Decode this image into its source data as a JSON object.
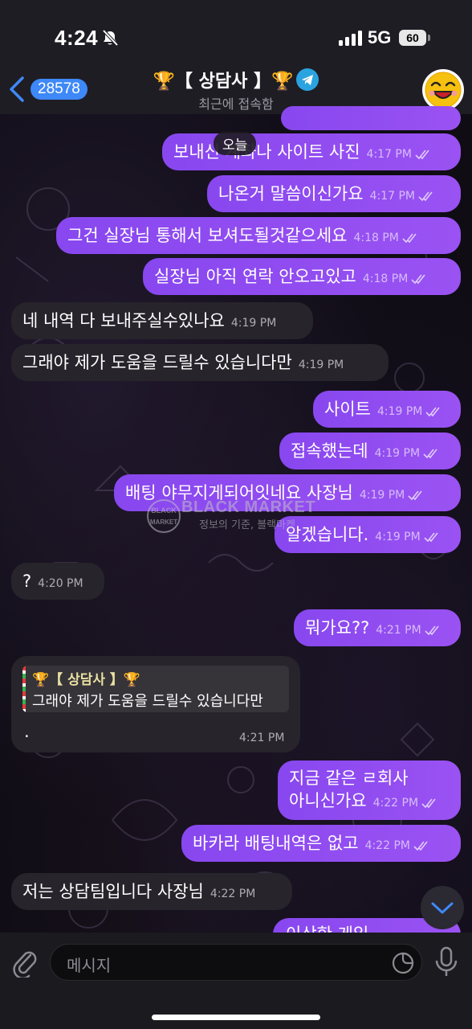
{
  "status_bar": {
    "time": "4:24",
    "network": "5G",
    "battery": "60"
  },
  "header": {
    "back_count": "28578",
    "title": "🏆【 상담사 】🏆",
    "subtitle": "최근에 접속함"
  },
  "date_pill": "오늘",
  "messages": [
    {
      "text": "보내신 계좌나 사이트 사진",
      "time": "4:17 PM"
    },
    {
      "text": "나온거 말씀이신가요",
      "time": "4:17 PM"
    },
    {
      "text": "그건 실장님 통해서 보셔도될것같으세요",
      "time": "4:18 PM"
    },
    {
      "text": "실장님 아직 연락 안오고있고",
      "time": "4:18 PM"
    },
    {
      "text": "네 내역 다 보내주실수있나요",
      "time": "4:19 PM"
    },
    {
      "text": "그래야 제가 도움을 드릴수 있습니다만",
      "time": "4:19 PM"
    },
    {
      "text": "사이트",
      "time": "4:19 PM"
    },
    {
      "text": "접속했는데",
      "time": "4:19 PM"
    },
    {
      "text": "배팅 야무지게되어잇네요 사장님",
      "time": "4:19 PM"
    },
    {
      "text": "알겠습니다.",
      "time": "4:19 PM"
    },
    {
      "text": "?",
      "time": "4:20 PM"
    },
    {
      "text": "뭐가요??",
      "time": "4:21 PM"
    },
    {
      "reply_name": "🏆【 상담사 】🏆",
      "reply_text": "그래야 제가 도움을 드릴수 있습니다만",
      "text": ".",
      "time": "4:21 PM"
    },
    {
      "line1": "지금 같은 ㄹ회사",
      "line2": "아니신가요",
      "time": "4:22 PM"
    },
    {
      "text": "바카라 배팅내역은 없고",
      "time": "4:22 PM"
    },
    {
      "text": "저는 상담팀입니다 사장님",
      "time": "4:22 PM"
    },
    {
      "text": "이상한 게임"
    }
  ],
  "watermark": {
    "title": "BLACK MARKET",
    "subtitle": "정보의 기준, 블랙마켓",
    "logo_top": "BLACK",
    "logo_bottom": "MARKET"
  },
  "input": {
    "placeholder": "메시지"
  },
  "colors": {
    "outgoing": "#8b4cf0",
    "incoming": "#27242b",
    "accent": "#3e88f7"
  }
}
